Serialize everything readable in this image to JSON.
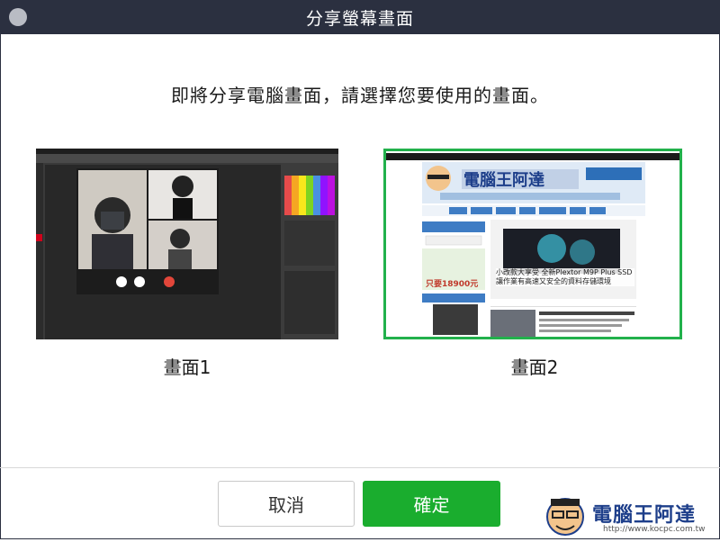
{
  "window": {
    "title": "分享螢幕畫面"
  },
  "prompt": {
    "text": "即將分享電腦畫面，請選擇您要使用的畫面。"
  },
  "screens": [
    {
      "label": "畫面1",
      "selected": false
    },
    {
      "label": "畫面2",
      "selected": true
    }
  ],
  "thumb2": {
    "site_title": "電腦王阿達",
    "article_headline": "小改款大享受 全新Plextor M9P Plus SSD 讓作業有高速又安全的資料存儲環境",
    "ad_price": "只要18900元"
  },
  "buttons": {
    "cancel_label": "取消",
    "ok_label": "確定"
  },
  "watermark": {
    "name": "電腦王阿達",
    "url": "http://www.kocpc.com.tw"
  },
  "colors": {
    "titlebar": "#2b3040",
    "accent_green": "#1aad2e",
    "selection_border": "#22b14c"
  }
}
